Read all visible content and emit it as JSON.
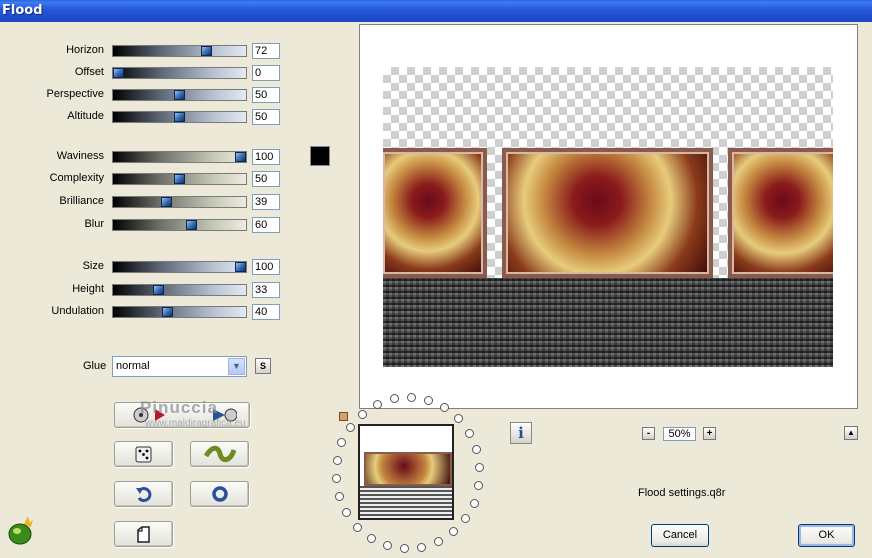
{
  "window": {
    "title": "Flood"
  },
  "sliders": [
    {
      "id": "horizon",
      "label": "Horizon",
      "value": "72",
      "level": 0.72
    },
    {
      "id": "offset",
      "label": "Offset",
      "value": "0",
      "level": 0.0
    },
    {
      "id": "perspective",
      "label": "Perspective",
      "value": "50",
      "level": 0.5
    },
    {
      "id": "altitude",
      "label": "Altitude",
      "value": "50",
      "level": 0.5
    },
    {
      "id": "waviness",
      "label": "Waviness",
      "value": "100",
      "level": 1.0
    },
    {
      "id": "complexity",
      "label": "Complexity",
      "value": "50",
      "level": 0.5
    },
    {
      "id": "brilliance",
      "label": "Brilliance",
      "value": "39",
      "level": 0.39
    },
    {
      "id": "blur",
      "label": "Blur",
      "value": "60",
      "level": 0.6
    },
    {
      "id": "size",
      "label": "Size",
      "value": "100",
      "level": 1.0
    },
    {
      "id": "height",
      "label": "Height",
      "value": "33",
      "level": 0.33
    },
    {
      "id": "undulation",
      "label": "Undulation",
      "value": "40",
      "level": 0.4
    }
  ],
  "glue": {
    "label": "Glue",
    "value": "normal",
    "s_label": "S"
  },
  "color_swatch": "#000000",
  "watermark": {
    "name": "Pinuccia",
    "site": "www.maldiragrafica.eu"
  },
  "preview": {
    "zoom": "50%"
  },
  "settings_file": "Flood settings.q8r",
  "buttons": {
    "cancel": "Cancel",
    "ok": "OK",
    "info": "i",
    "zoom_out": "-",
    "zoom_in": "+"
  }
}
